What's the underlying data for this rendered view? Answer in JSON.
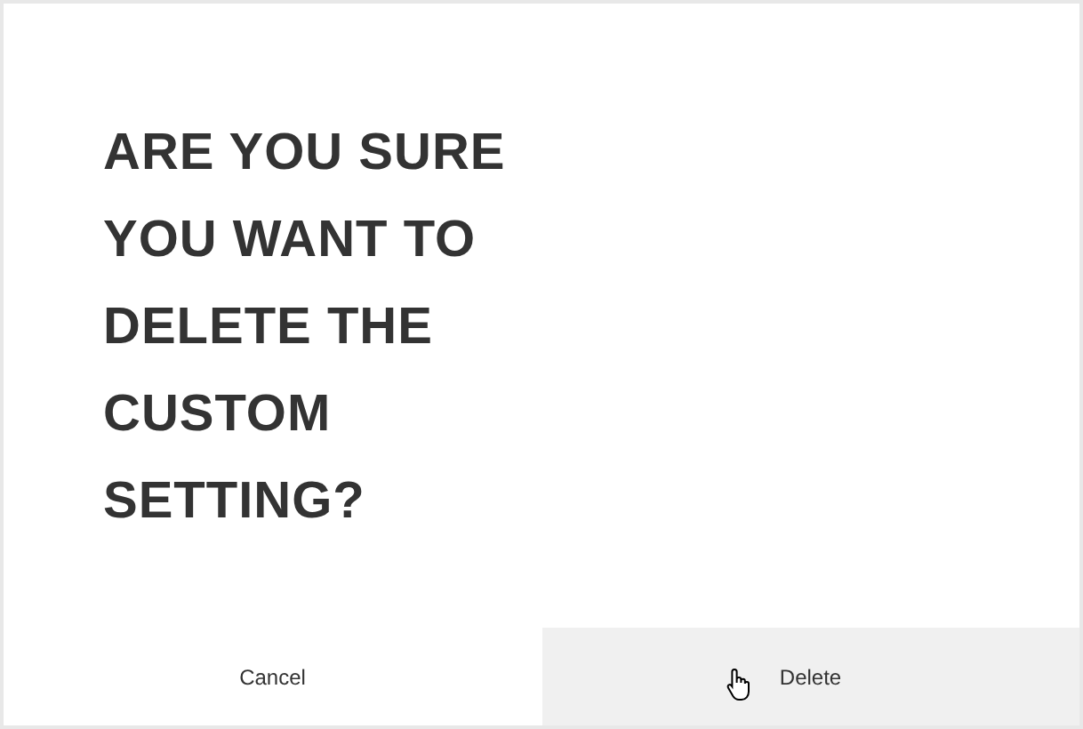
{
  "dialog": {
    "message": "ARE YOU SURE YOU WANT TO DELETE THE CUSTOM SETTING?",
    "buttons": [
      {
        "label": "Cancel",
        "hovered": false
      },
      {
        "label": "Delete",
        "hovered": true
      }
    ]
  }
}
